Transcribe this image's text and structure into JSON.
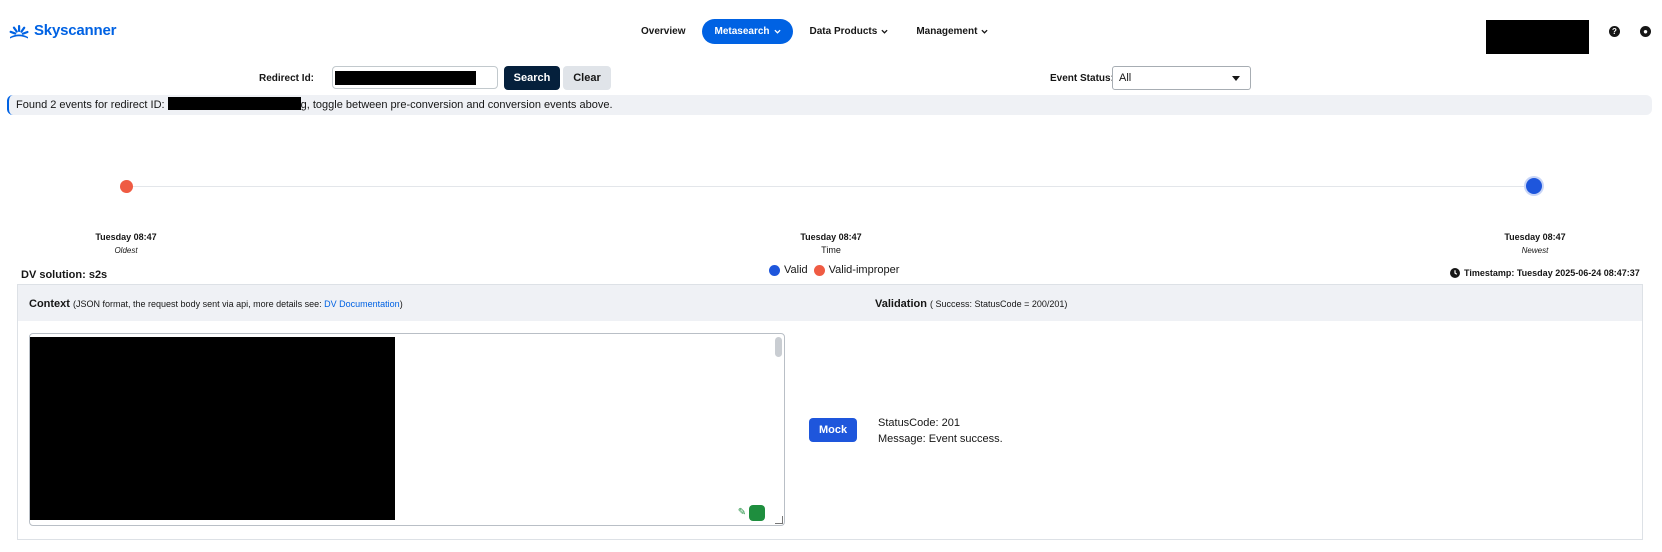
{
  "header": {
    "logo_text": "Skyscanner",
    "nav": [
      {
        "label": "Overview",
        "active": false,
        "dropdown": false
      },
      {
        "label": "Metasearch",
        "active": true,
        "dropdown": true
      },
      {
        "label": "Data Products",
        "active": false,
        "dropdown": true
      },
      {
        "label": "Management",
        "active": false,
        "dropdown": true
      }
    ],
    "help_icon": "question-circle-icon",
    "user_icon": "user-circle-icon",
    "help_glyph": "?",
    "user_glyph": "●"
  },
  "search": {
    "redirect_label": "Redirect Id:",
    "search_label": "Search",
    "clear_label": "Clear",
    "status_label": "Event Status:",
    "status_value": "All"
  },
  "banner": {
    "prefix": "Found 2 events for redirect ID: ",
    "suffix": "g, toggle between pre-conversion and conversion events above."
  },
  "timeline": {
    "left_time": "Tuesday 08:47",
    "left_sub": "Oldest",
    "mid_time": "Tuesday 08:47",
    "mid_sub": "Time",
    "right_time": "Tuesday 08:47",
    "right_sub": "Newest",
    "legend": [
      {
        "label": "Valid",
        "color": "#1e56dc"
      },
      {
        "label": "Valid-improper",
        "color": "#ef5b43"
      }
    ]
  },
  "event": {
    "dv_solution": "DV solution: s2s",
    "timestamp": "Timestamp: Tuesday 2025-06-24 08:47:37"
  },
  "panel": {
    "context_title": "Context",
    "context_note_prefix": "(JSON format, the request body sent via api, more details see: ",
    "context_link": "DV Documentation",
    "context_note_suffix": ")",
    "validation_title": "Validation",
    "validation_note": "( Success: StatusCode = 200/201)",
    "mock_label": "Mock",
    "status_code": "StatusCode: 201",
    "message": "Message: Event success."
  },
  "colors": {
    "brand": "#0062e3",
    "valid": "#1e56dc",
    "valid_improper": "#ef5b43",
    "search_button": "#05203c"
  }
}
